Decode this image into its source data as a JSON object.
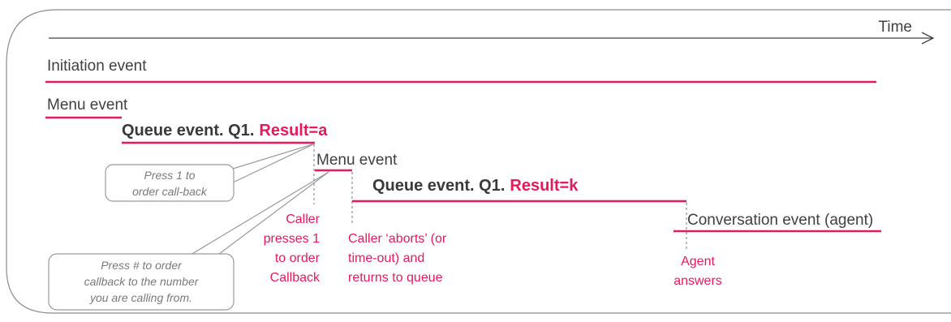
{
  "time_label": "Time",
  "events": {
    "initiation": "Initiation event",
    "menu1": "Menu event",
    "queue1": {
      "name": "Queue event. Q1.",
      "result": "Result=a"
    },
    "menu2": "Menu event",
    "queue2": {
      "name": "Queue event. Q1.",
      "result": "Result=k"
    },
    "conversation": "Conversation event (agent)"
  },
  "notes": {
    "press1": [
      "Press 1 to",
      "order call-back"
    ],
    "pressHash": [
      "Press # to order",
      "callback to the number",
      "you are calling from."
    ]
  },
  "annotations": {
    "caller_presses": [
      "Caller",
      "presses 1",
      "to order",
      "Callback"
    ],
    "caller_aborts": [
      "Caller ‘aborts’ (or",
      "time-out) and",
      "returns to queue"
    ],
    "agent_answers": [
      "Agent",
      "answers"
    ]
  },
  "colors": {
    "accent": "#e6195a",
    "text": "#404040",
    "frame": "#8c8c8c"
  }
}
